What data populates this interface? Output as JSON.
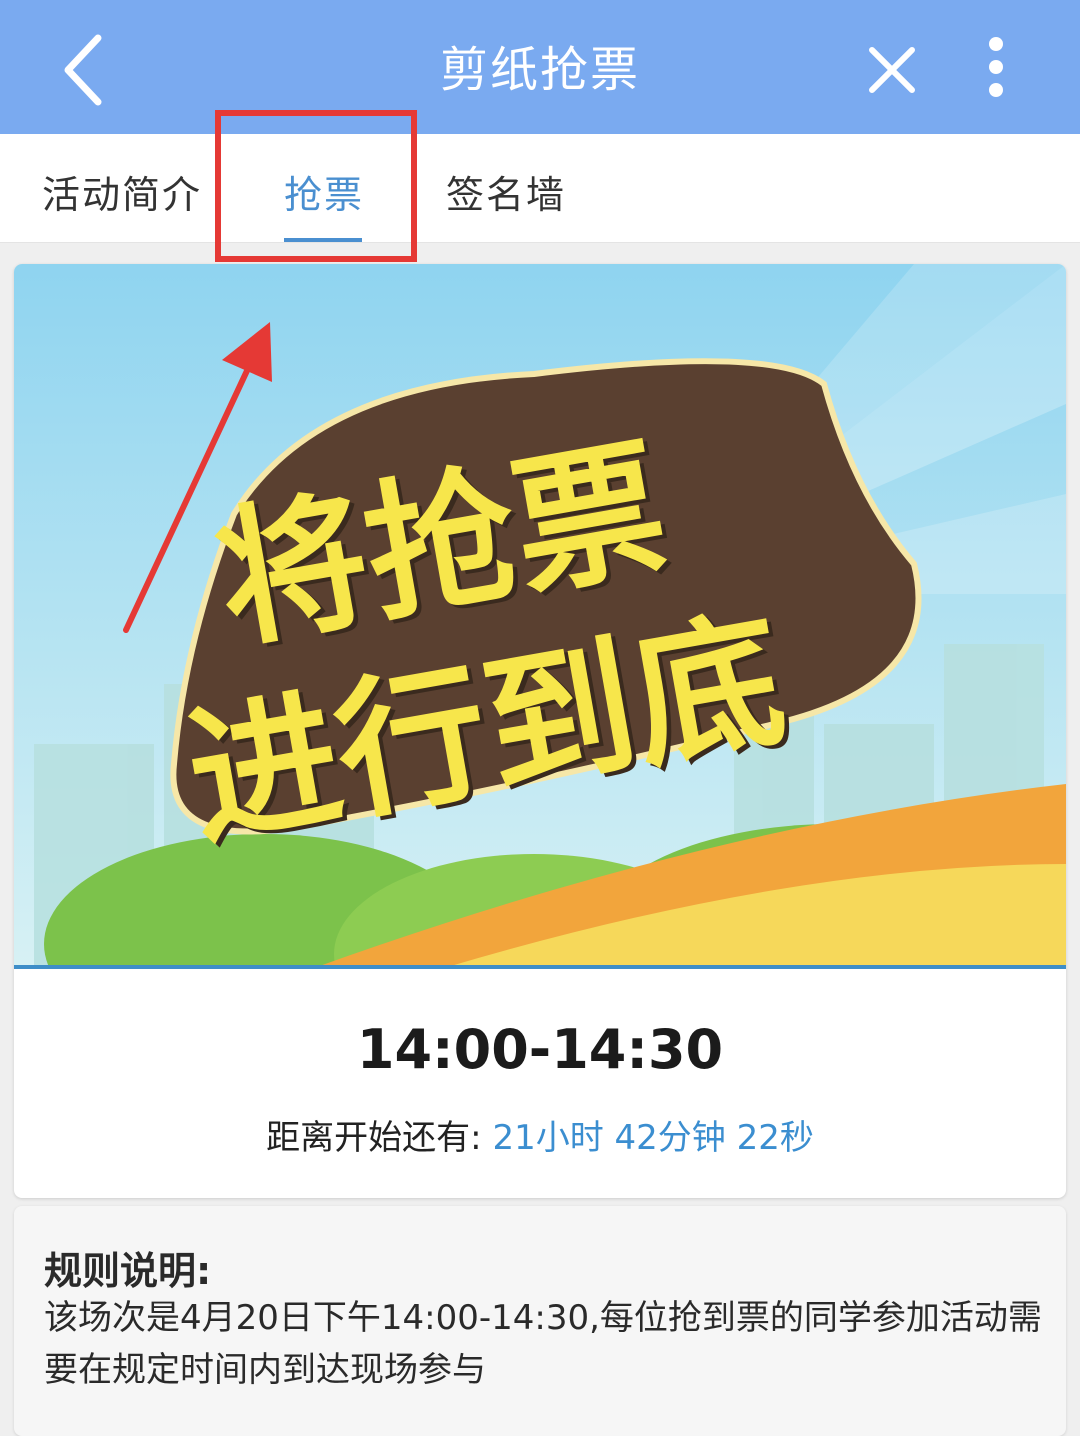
{
  "header": {
    "title": "剪纸抢票",
    "back_icon": "chevron-left-icon",
    "close_icon": "close-icon",
    "more_icon": "more-vertical-icon",
    "background_color": "#7aaaf0"
  },
  "tabs": [
    {
      "label": "活动简介",
      "active": false
    },
    {
      "label": "抢票",
      "active": true
    },
    {
      "label": "签名墙",
      "active": false
    }
  ],
  "banner": {
    "line1": "将抢票",
    "line2": "进行到底"
  },
  "session": {
    "time_range": "14:00-14:30",
    "countdown_label": "距离开始还有:",
    "countdown_value": "21小时 42分钟 22秒"
  },
  "rules": {
    "title": "规则说明:",
    "text": "该场次是4月20日下午14:00-14:30,每位抢到票的同学参加活动需要在规定时间内到达现场参与"
  },
  "colors": {
    "accent": "#4a8fd0",
    "annotation_red": "#e53935"
  }
}
